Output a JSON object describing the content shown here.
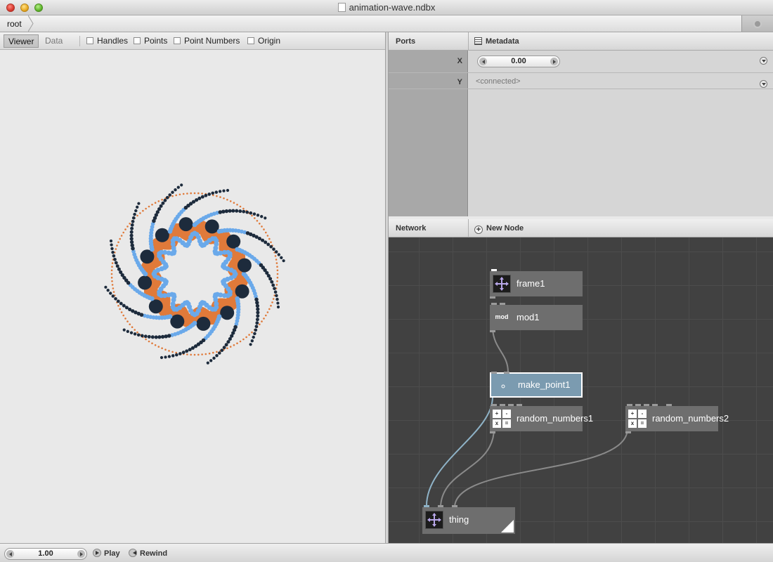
{
  "window": {
    "title": "animation-wave.ndbx"
  },
  "breadcrumb": {
    "root": "root"
  },
  "viewer": {
    "tabs": [
      {
        "label": "Viewer",
        "active": true
      },
      {
        "label": "Data",
        "active": false
      }
    ],
    "toggles": [
      {
        "label": "Handles",
        "checked": false
      },
      {
        "label": "Points",
        "checked": false
      },
      {
        "label": "Point Numbers",
        "checked": false
      },
      {
        "label": "Origin",
        "checked": false
      }
    ]
  },
  "ports": {
    "header": "Ports",
    "metadata": "Metadata",
    "rows": [
      {
        "name": "X",
        "value": "0.00"
      },
      {
        "name": "Y",
        "value": "<connected>"
      }
    ]
  },
  "network": {
    "header": "Network",
    "new_node": "New Node",
    "nodes": [
      {
        "name": "frame1",
        "icon": "move-icon"
      },
      {
        "name": "mod1",
        "icon": "mod"
      },
      {
        "name": "make_point1",
        "icon": "point-icon",
        "selected": true
      },
      {
        "name": "random_numbers1",
        "icon": "math-icon",
        "glyphs": [
          "+",
          "-",
          "x",
          "="
        ]
      },
      {
        "name": "random_numbers2",
        "icon": "math-icon",
        "glyphs": [
          "+",
          "-",
          "x",
          "="
        ]
      },
      {
        "name": "thing",
        "icon": "move-icon",
        "rendered": true
      }
    ]
  },
  "playback": {
    "frame": "1.00",
    "play": "Play",
    "rewind": "Rewind"
  },
  "colors": {
    "orange": "#e07a3a",
    "blue": "#6aa9ea",
    "dark": "#1d2b3c",
    "selected_node": "#7b9bb0"
  }
}
